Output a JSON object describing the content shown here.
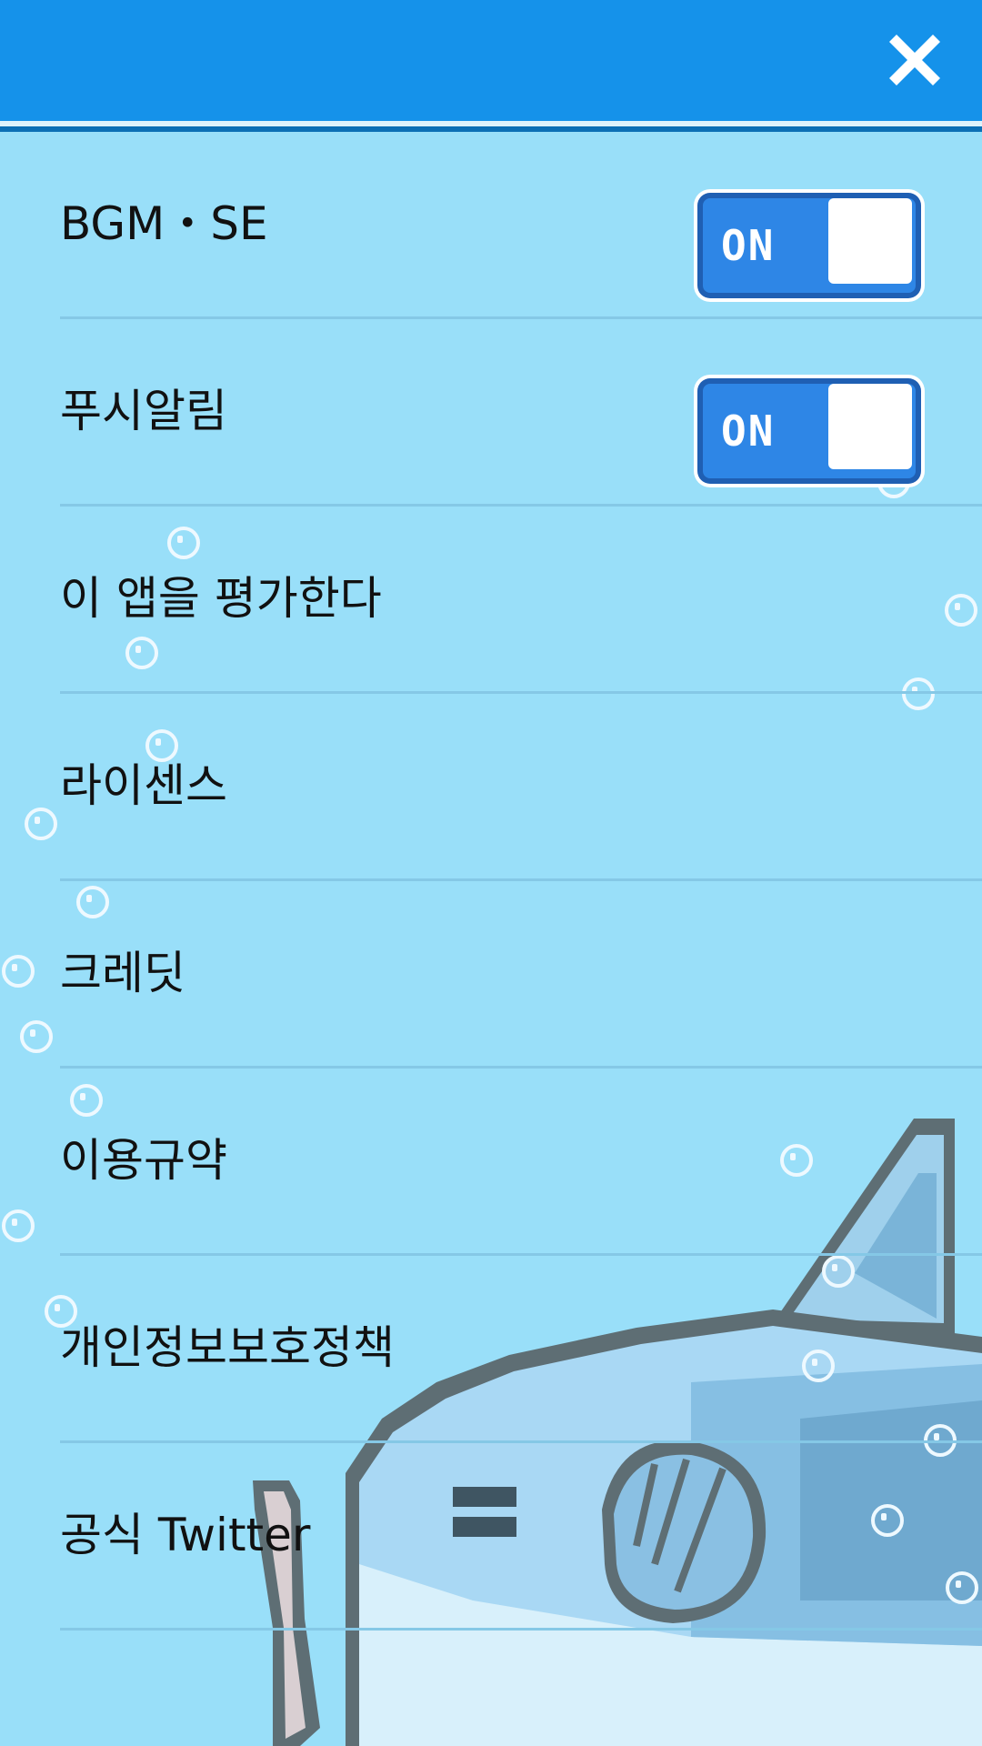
{
  "header": {
    "close_icon": "close-icon",
    "colors": {
      "bar": "#1592ea",
      "accent_line": "#0c6fb5"
    }
  },
  "settings": {
    "items": [
      {
        "label": "BGM・SE",
        "toggle": "ON"
      },
      {
        "label": "푸시알림",
        "toggle": "ON"
      },
      {
        "label": "이 앱을 평가한다"
      },
      {
        "label": "라이센스"
      },
      {
        "label": "크레딧"
      },
      {
        "label": "이용규약"
      },
      {
        "label": "개인정보보호정책"
      },
      {
        "label": "공식 Twitter"
      }
    ]
  },
  "colors": {
    "background": "#99dff9",
    "toggle_on": "#2e86e6",
    "divider": "#85c8e6"
  }
}
